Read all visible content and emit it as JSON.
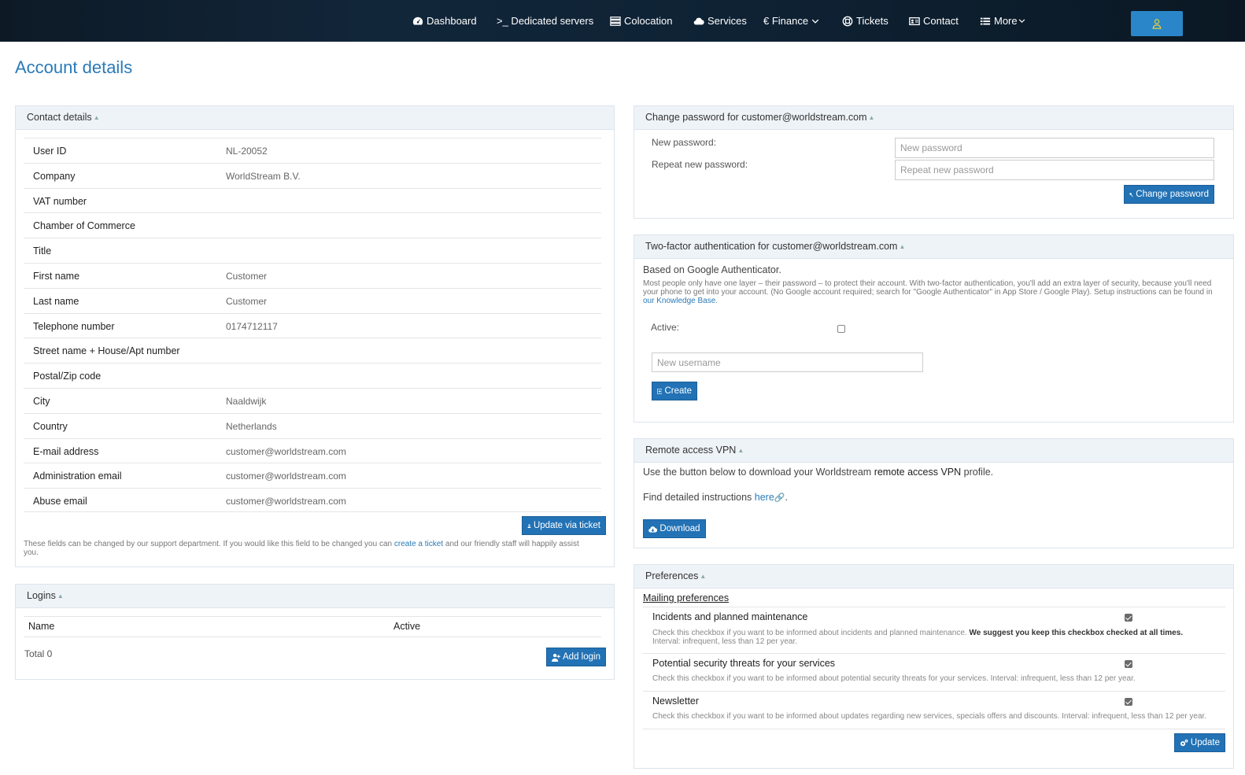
{
  "nav": {
    "items": [
      {
        "label": "Dashboard",
        "icon": "dashboard-icon"
      },
      {
        "label": ">_ Dedicated servers",
        "icon": "terminal-icon"
      },
      {
        "label": "Colocation",
        "icon": "server-rack-icon"
      },
      {
        "label": "Services",
        "icon": "cloud-icon"
      },
      {
        "label": "€ Finance",
        "icon": "chevron-down-icon"
      },
      {
        "label": "Tickets",
        "icon": "lifebuoy-icon"
      },
      {
        "label": "Contact",
        "icon": "contact-card-icon"
      },
      {
        "label": "More",
        "icon": "list-icon"
      }
    ],
    "user_icon": "user-icon",
    "colors": {
      "bar": "#0e2234",
      "user_button": "#2a86c8"
    }
  },
  "page": {
    "title": "Account details",
    "accent": "#2a7ab8"
  },
  "contact": {
    "header": "Contact details",
    "rows": [
      {
        "label": "User ID",
        "value": "NL-20052"
      },
      {
        "label": "Company",
        "value": "WorldStream B.V."
      },
      {
        "label": "VAT number",
        "value": ""
      },
      {
        "label": "Chamber of Commerce",
        "value": ""
      },
      {
        "label": "Title",
        "value": ""
      },
      {
        "label": "First name",
        "value": "Customer"
      },
      {
        "label": "Last name",
        "value": "Customer"
      },
      {
        "label": "Telephone number",
        "value": "0174712117"
      },
      {
        "label": "Street name + House/Apt number",
        "value": ""
      },
      {
        "label": "Postal/Zip code",
        "value": ""
      },
      {
        "label": "City",
        "value": "Naaldwijk"
      },
      {
        "label": "Country",
        "value": "Netherlands"
      },
      {
        "label": "E-mail address",
        "value": "customer@worldstream.com"
      },
      {
        "label": "Administration email",
        "value": "customer@worldstream.com"
      },
      {
        "label": "Abuse email",
        "value": "customer@worldstream.com"
      }
    ],
    "update_button": "Update via ticket",
    "note_before": "These fields can be changed by our support department. If you would like this field to be changed you can ",
    "note_link": "create a ticket",
    "note_after": " and our friendly staff will happily assist you."
  },
  "logins": {
    "header": "Logins",
    "col_name": "Name",
    "col_active": "Active",
    "total": "Total 0",
    "add_button": "Add login"
  },
  "password": {
    "header": "Change password for customer@worldstream.com",
    "new_label": "New password:",
    "repeat_label": "Repeat new password:",
    "new_placeholder": "New password",
    "repeat_placeholder": "Repeat new password",
    "button": "Change password"
  },
  "twofa": {
    "header": "Two-factor authentication for customer@worldstream.com",
    "subtitle": "Based on Google Authenticator.",
    "desc_before": "Most people only have one layer – their password – to protect their account. With two-factor authentication, you'll add an extra layer of security, because you'll need your phone to get into your account. (No Google account required; search for \"Google Authenticator\" in App Store / Google Play). Setup instructions can be found in ",
    "desc_link": "our Knowledge Base",
    "desc_after": ".",
    "active_label": "Active:",
    "active_checked": false,
    "username_placeholder": "New username",
    "create_button": "Create"
  },
  "vpn": {
    "header": "Remote access VPN",
    "line1_before": "Use the button below to download your Worldstream ",
    "line1_bold": "remote access VPN",
    "line1_after": " profile.",
    "line2_before": "Find detailed instructions ",
    "line2_link": "here",
    "line2_after": ".",
    "download_button": "Download"
  },
  "preferences": {
    "header": "Preferences",
    "mailing_link": "Mailing preferences",
    "items": [
      {
        "title": "Incidents and planned maintenance",
        "desc": "Check this checkbox if you want to be informed about incidents and planned maintenance. ",
        "desc_bold": "We suggest you keep this checkbox checked at all times.",
        "desc2": "Interval: infrequent, less than 12 per year.",
        "checked": true
      },
      {
        "title": "Potential security threats for your services",
        "desc": "Check this checkbox if you want to be informed about potential security threats for your services. Interval: infrequent, less than 12 per year.",
        "checked": true
      },
      {
        "title": "Newsletter",
        "desc": "Check this checkbox if you want to be informed about updates regarding new services, specials offers and discounts. Interval: infrequent, less than 12 per year.",
        "checked": true
      }
    ],
    "update_button": "Update"
  }
}
